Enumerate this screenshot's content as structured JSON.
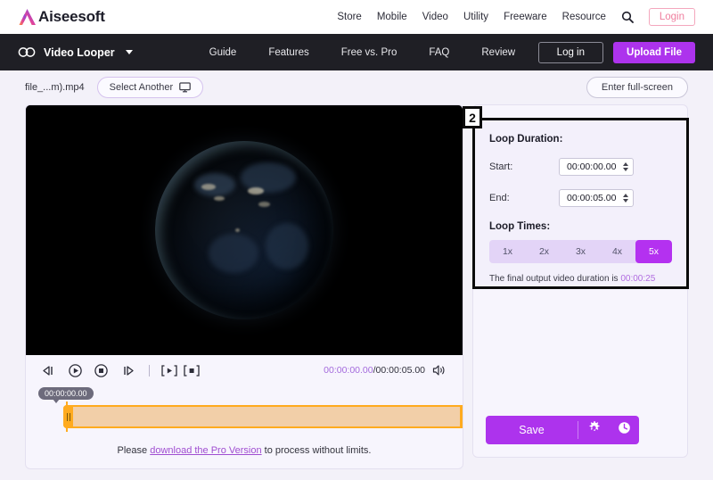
{
  "topbar": {
    "logo_text": "Aiseesoft",
    "nav": [
      {
        "label": "Store"
      },
      {
        "label": "Mobile"
      },
      {
        "label": "Video"
      },
      {
        "label": "Utility"
      },
      {
        "label": "Freeware"
      },
      {
        "label": "Resource"
      }
    ],
    "search_icon": "search-icon",
    "login_label": "Login"
  },
  "navbar": {
    "brand_icon": "infinity-loop-icon",
    "brand_name": "Video Looper",
    "links": [
      {
        "label": "Guide"
      },
      {
        "label": "Features"
      },
      {
        "label": "Free vs. Pro"
      },
      {
        "label": "FAQ"
      },
      {
        "label": "Review"
      }
    ],
    "login_label": "Log in",
    "upload_label": "Upload File"
  },
  "filerow": {
    "filename": "file_...m).mp4",
    "select_another_label": "Select Another",
    "select_another_icon": "monitor-icon",
    "fullscreen_label": "Enter full-screen"
  },
  "player": {
    "controls": [
      {
        "name": "rewind-icon"
      },
      {
        "name": "play-circle-icon"
      },
      {
        "name": "stop-circle-icon"
      },
      {
        "name": "fast-forward-icon"
      }
    ],
    "mark_in_icon": "set-start-bracket-icon",
    "mark_out_icon": "set-end-bracket-icon",
    "current_time": "00:00:00.00",
    "time_separator": "/",
    "total_time": "00:00:05.00",
    "volume_icon": "volume-icon",
    "timeline_tooltip": "00:00:00.00"
  },
  "pro_notice": {
    "prefix": "Please ",
    "link": "download the Pro Version",
    "suffix": " to process without limits."
  },
  "panel": {
    "badge": "2",
    "loop_duration_title": "Loop Duration:",
    "start_label": "Start:",
    "start_value": "00:00:00.00",
    "end_label": "End:",
    "end_value": "00:00:05.00",
    "loop_times_title": "Loop Times:",
    "loop_options": [
      {
        "label": "1x",
        "selected": false
      },
      {
        "label": "2x",
        "selected": false
      },
      {
        "label": "3x",
        "selected": false
      },
      {
        "label": "4x",
        "selected": false
      },
      {
        "label": "5x",
        "selected": true
      }
    ],
    "final_note_prefix": "The final output video duration is ",
    "final_duration": "00:00:25",
    "save_label": "Save",
    "settings_icon": "gear-icon",
    "history_icon": "clock-icon"
  },
  "colors": {
    "accent_purple": "#ad33ed",
    "selected_purple": "#b431f0",
    "login_pink": "#ef7e9e",
    "timeline_orange": "#ffab1f",
    "dark_nav": "#1f1f25"
  }
}
